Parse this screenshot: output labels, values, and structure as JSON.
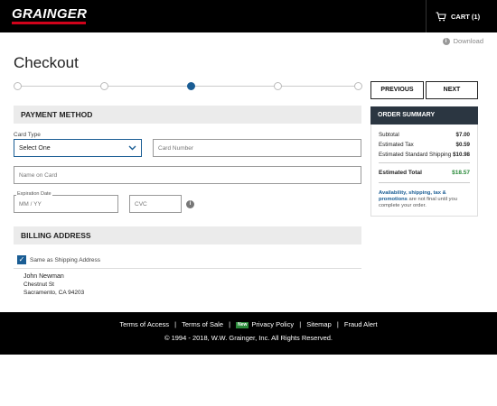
{
  "header": {
    "logo": "GRAINGER",
    "cart_label": "CART (1)",
    "brand_red": "#d0021b"
  },
  "download_label": "Download",
  "page_title": "Checkout",
  "stepper": {
    "total_steps": 5,
    "current_step": 3
  },
  "payment": {
    "section_title": "PAYMENT METHOD",
    "card_type_label": "Card Type",
    "card_type_value": "Select One",
    "card_number_placeholder": "Card Number",
    "name_on_card_placeholder": "Name on Card",
    "expiration_label": "Expiration Date",
    "expiration_placeholder": "MM / YY",
    "cvc_placeholder": "CVC"
  },
  "billing": {
    "section_title": "BILLING ADDRESS",
    "same_as_shipping_label": "Same as Shipping Address",
    "same_as_shipping_checked": true,
    "name": "John Newman",
    "street": "Chestnut St",
    "city_line": "Sacramento, CA 94203"
  },
  "nav": {
    "previous_label": "PREVIOUS",
    "next_label": "NEXT"
  },
  "order_summary": {
    "title": "ORDER SUMMARY",
    "rows": [
      {
        "label": "Subtotal",
        "value": "$7.00"
      },
      {
        "label": "Estimated Tax",
        "value": "$0.59"
      },
      {
        "label": "Estimated Standard Shipping",
        "value": "$10.98"
      }
    ],
    "total_label": "Estimated Total",
    "total_value": "$18.57",
    "note_highlight": "Availability, shipping, tax & promotions",
    "note_rest": " are not final until you complete your order."
  },
  "footer": {
    "links": [
      "Terms of Access",
      "Terms of Sale",
      "Privacy Policy",
      "Sitemap",
      "Fraud Alert"
    ],
    "new_badge": "New",
    "separator": "|",
    "copyright": "© 1994 - 2018, W.W. Grainger, Inc. All Rights Reserved."
  },
  "colors": {
    "accent_blue": "#1a5d94",
    "summary_header": "#2b3641",
    "total_green": "#2a8a3a"
  }
}
